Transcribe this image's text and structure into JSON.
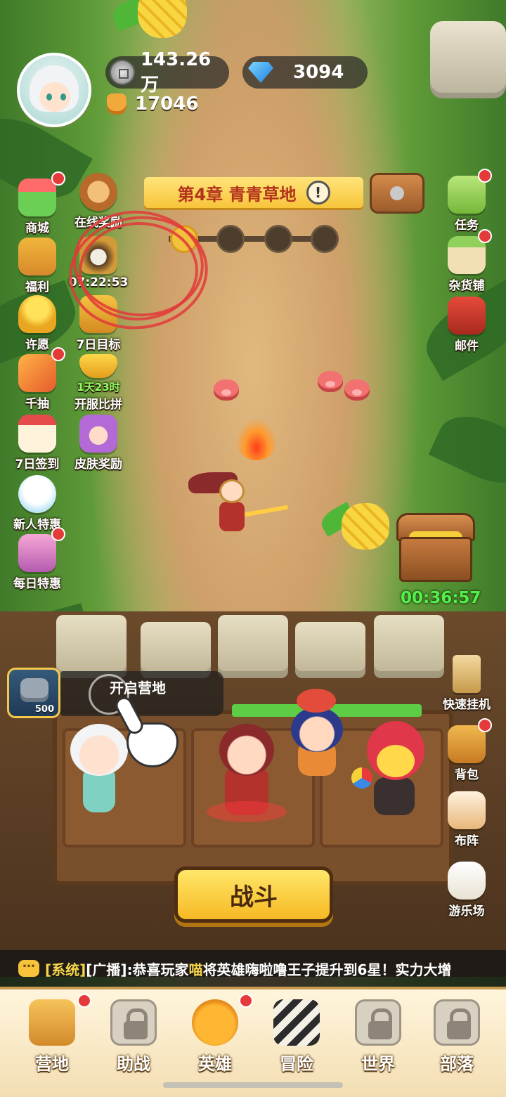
{
  "resources": {
    "coins": "143.26万",
    "gems": "3094",
    "power": "17046"
  },
  "chapter": {
    "title": "第4章 青青草地",
    "info_icon": "!"
  },
  "left_menu": {
    "shop": "商城",
    "online_rewards": "在线奖励",
    "welfare": "福利",
    "skull_timer": "07:22:53",
    "wish": "许愿",
    "seven_day_goal": "7日目标",
    "thousand_draw": "千抽",
    "server_race_timer": "1天23时",
    "server_race": "开服比拼",
    "seven_day_signin": "7日签到",
    "skin_reward": "皮肤奖励",
    "newbie_deal": "新人特惠",
    "daily_deal": "每日特惠"
  },
  "right_menu": {
    "tasks": "任务",
    "general_store": "杂货铺",
    "mail": "邮件",
    "quick_idle": "快速挂机",
    "backpack": "背包",
    "formation": "布阵",
    "playground": "游乐场"
  },
  "chest": {
    "timer": "00:36:57"
  },
  "camp": {
    "cost": "500",
    "open_label": "开启营地"
  },
  "battle_button": "战斗",
  "broadcast": {
    "system_tag": "[系统]",
    "channel_tag": "[广播]",
    "prefix": ":恭喜玩家",
    "player": "喵",
    "message": " 将英雄嗨啦噜王子提升到6星！实力大增"
  },
  "bottom_nav": {
    "camp": "营地",
    "assist": "助战",
    "heroes": "英雄",
    "adventure": "冒险",
    "world": "世界",
    "tribe": "部落"
  },
  "colors": {
    "notification_dot": "#e43a3a",
    "timer_green": "#54f04a",
    "chapter_text": "#b3341d",
    "annotation_red": "#e23a3a"
  }
}
